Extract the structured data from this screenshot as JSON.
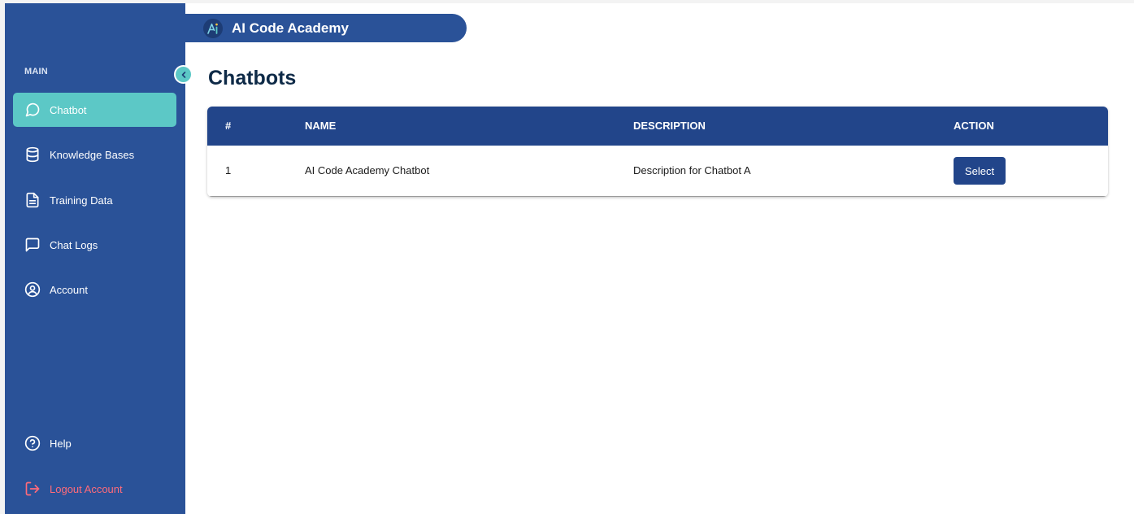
{
  "app": {
    "brand_name": "AI Code Academy",
    "accent_color": "#5cc8c6",
    "sidebar_color": "#2a5298",
    "table_header_color": "#22458a"
  },
  "sidebar": {
    "section_label": "MAIN",
    "items": [
      {
        "label": "Chatbot",
        "icon": "chat-bubble-icon",
        "active": true
      },
      {
        "label": "Knowledge Bases",
        "icon": "database-icon",
        "active": false
      },
      {
        "label": "Training Data",
        "icon": "document-icon",
        "active": false
      },
      {
        "label": "Chat Logs",
        "icon": "message-square-icon",
        "active": false
      },
      {
        "label": "Account",
        "icon": "user-circle-icon",
        "active": false
      }
    ],
    "bottom_items": [
      {
        "label": "Help",
        "icon": "help-circle-icon"
      },
      {
        "label": "Logout Account",
        "icon": "logout-icon",
        "color": "#ff6b7a"
      }
    ]
  },
  "main": {
    "title": "Chatbots",
    "table": {
      "columns": [
        "#",
        "NAME",
        "DESCRIPTION",
        "ACTION"
      ],
      "rows": [
        {
          "index": "1",
          "name": "AI Code Academy Chatbot",
          "description": "Description for Chatbot A",
          "action_label": "Select"
        }
      ]
    }
  }
}
